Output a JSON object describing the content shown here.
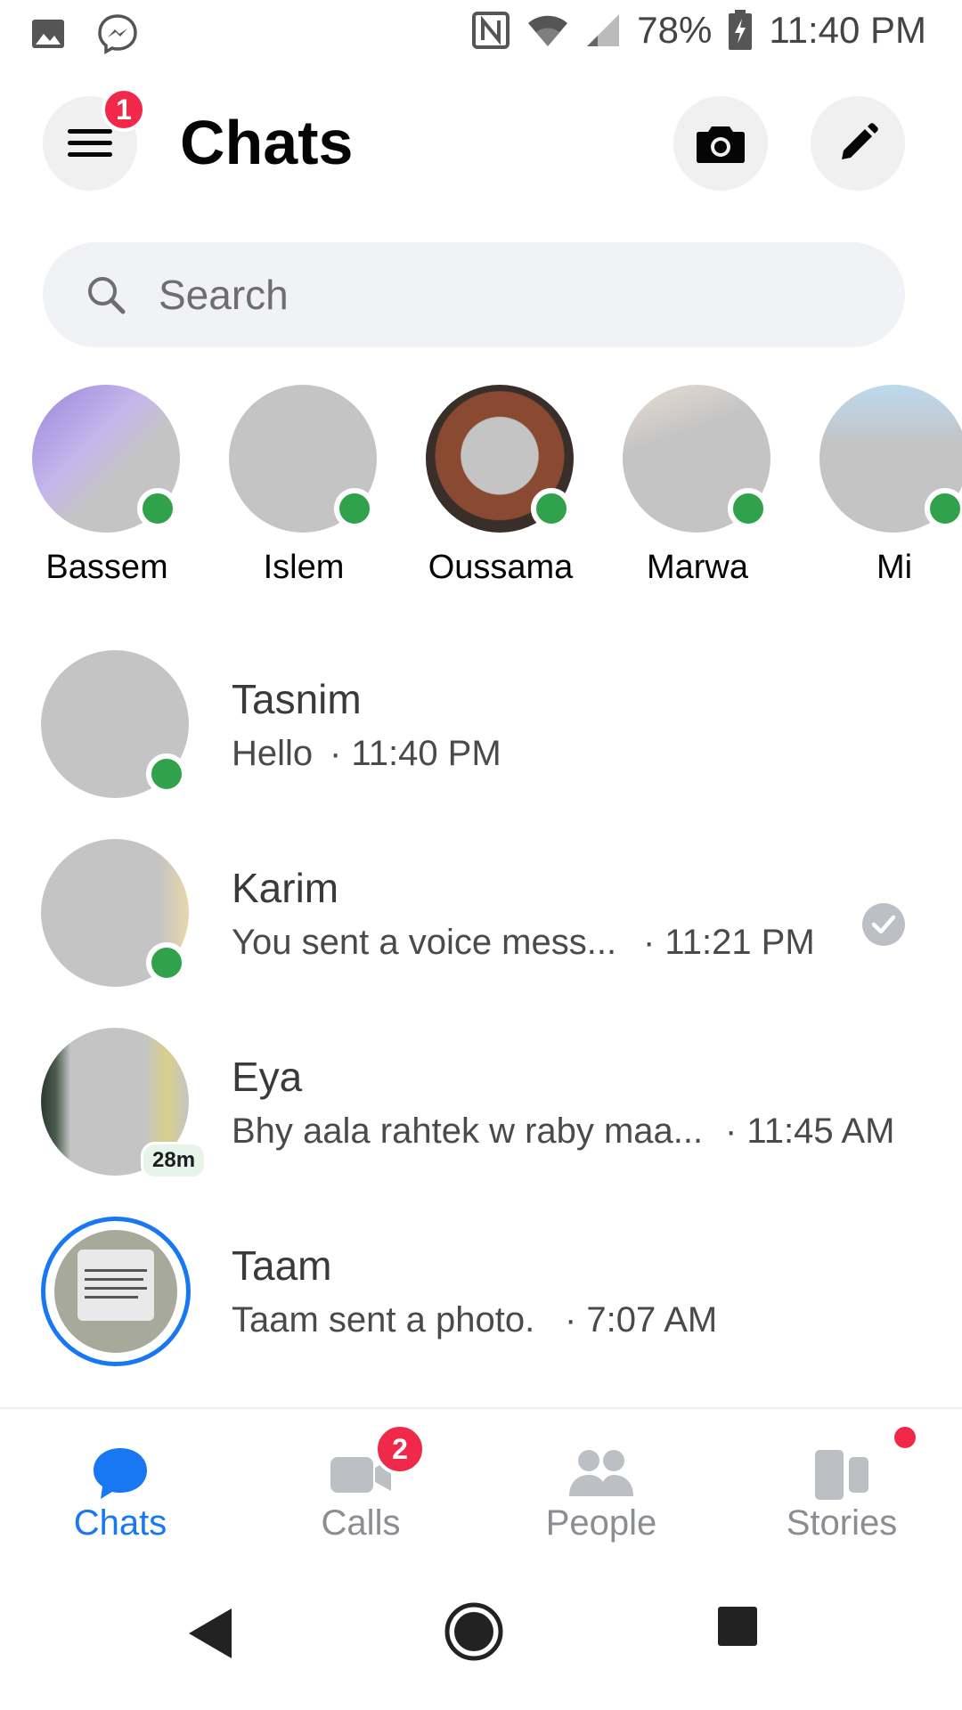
{
  "status_bar": {
    "battery": "78%",
    "time": "11:40 PM",
    "icons": [
      "gallery-icon",
      "messenger-icon",
      "nfc-icon",
      "wifi-icon",
      "signal-icon",
      "battery-charging-icon"
    ]
  },
  "header": {
    "title": "Chats",
    "menu_badge": "1"
  },
  "search": {
    "placeholder": "Search"
  },
  "active_contacts": [
    {
      "name": "Bassem",
      "online": true
    },
    {
      "name": "Islem",
      "online": true
    },
    {
      "name": "Oussama",
      "online": true
    },
    {
      "name": "Marwa",
      "online": true
    },
    {
      "name": "Mi",
      "online": true
    }
  ],
  "chats": [
    {
      "name": "Tasnim",
      "preview": "Hello",
      "time": "· 11:40 PM",
      "online": true
    },
    {
      "name": "Karim",
      "preview": "You sent a voice mess...",
      "time": "· 11:21 PM",
      "online": true,
      "seen": true
    },
    {
      "name": "Eya",
      "preview": "Bhy aala rahtek w raby maa...",
      "time": "· 11:45 AM",
      "active_ago": "28m"
    },
    {
      "name": "Taam",
      "preview": "Taam sent a photo.",
      "time": "· 7:07 AM",
      "story": true
    }
  ],
  "tabs": [
    {
      "label": "Chats",
      "icon": "chat-bubble-icon",
      "active": true
    },
    {
      "label": "Calls",
      "icon": "video-call-icon",
      "badge": "2"
    },
    {
      "label": "People",
      "icon": "people-icon"
    },
    {
      "label": "Stories",
      "icon": "stories-icon",
      "dot": true
    }
  ],
  "colors": {
    "accent": "#1877f2",
    "online": "#31a24c",
    "badge": "#f02849",
    "inactive": "#8a8d91"
  }
}
